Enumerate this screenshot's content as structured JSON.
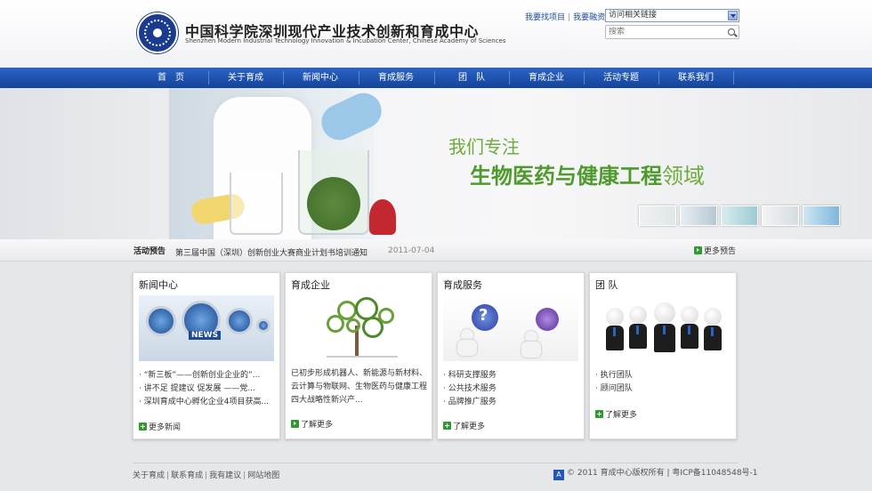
{
  "header": {
    "title_cn": "中国科学院深圳现代产业技术创新和育成中心",
    "title_en": "Shenzhen Modern Industrial Technology Innovation & Incubation Center, Chinese Academy of Sciences",
    "link_find_project": "我要找项目",
    "link_financing": "我要融资",
    "link_separator": "|",
    "related_links_select": "访问相关链接",
    "search_placeholder": "搜索"
  },
  "nav": {
    "items": [
      {
        "label": "首　页"
      },
      {
        "label": "关于育成"
      },
      {
        "label": "新闻中心"
      },
      {
        "label": "育成服务"
      },
      {
        "label": "团　队"
      },
      {
        "label": "育成企业"
      },
      {
        "label": "活动专题"
      },
      {
        "label": "联系我们"
      }
    ]
  },
  "banner": {
    "slogan_line1": "我们专注",
    "slogan_line2_bold": "生物医药与健康工程",
    "slogan_line2_light": "领域"
  },
  "announcement": {
    "title": "活动预告",
    "text": "第三届中国（深圳）创新创业大赛商业计划书培训通知",
    "date": "2011-07-04",
    "more_label": "更多预告"
  },
  "cards": [
    {
      "title": "新闻中心",
      "items": [
        "“新三板”——创新创业企业的”...",
        "讲不足 提建议 促发展 ——党...",
        "深圳育成中心孵化企业4项目获高..."
      ],
      "more_label": "更多新闻",
      "img_text": "NEWS"
    },
    {
      "title": "育成企业",
      "desc": "已初步形成机器人、新能源与新材料、云计算与物联网、生物医药与健康工程四大战略性新兴产...",
      "more_label": "了解更多"
    },
    {
      "title": "育成服务",
      "items": [
        "科研支撑服务",
        "公共技术服务",
        "品牌推广服务"
      ],
      "more_label": "了解更多",
      "img_text": "?"
    },
    {
      "title": "团 队",
      "items": [
        "执行团队",
        "顾问团队"
      ],
      "more_label": "了解更多"
    }
  ],
  "footer": {
    "links": [
      "关于育成",
      "联系育成",
      "我有建议",
      "网站地图"
    ],
    "separator": "|",
    "badge": "A",
    "copyright": "© 2011 育成中心版权所有 | 粤ICP备11048548号-1"
  }
}
